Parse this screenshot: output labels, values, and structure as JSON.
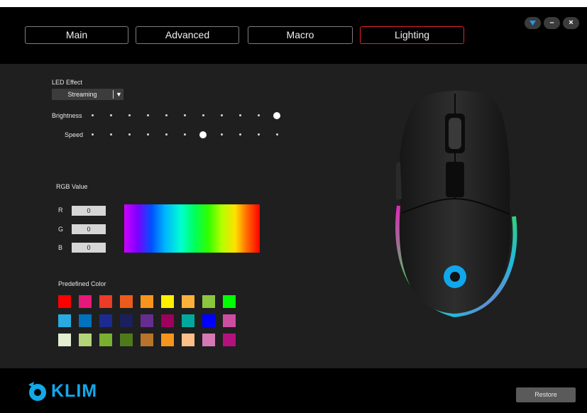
{
  "window": {
    "tabs": [
      {
        "label": "Main"
      },
      {
        "label": "Advanced"
      },
      {
        "label": "Macro"
      },
      {
        "label": "Lighting"
      }
    ],
    "active_tab": "Lighting",
    "controls": {
      "menu_icon": "triangle-down-icon",
      "minimize": "–",
      "close": "×"
    }
  },
  "lighting": {
    "led_effect_label": "LED Effect",
    "led_effect_value": "Streaming",
    "brightness_label": "Brightness",
    "brightness_level": 10,
    "speed_label": "Speed",
    "speed_level": 6,
    "slider_steps": 10,
    "rgb_title": "RGB Value",
    "rgb": [
      {
        "label": "R",
        "value": "0"
      },
      {
        "label": "G",
        "value": "0"
      },
      {
        "label": "B",
        "value": "0"
      }
    ],
    "predefined_title": "Predefined Color",
    "predefined_colors": [
      [
        "#ff0000",
        "#e6197a",
        "#ec3b26",
        "#ec5b1c",
        "#f7941d",
        "#ffef00",
        "#fbb03b",
        "#8cc63f",
        "#00ff00"
      ],
      [
        "#29abe2",
        "#0071bc",
        "#1b2b8f",
        "#1b1f5c",
        "#662d91",
        "#9e005d",
        "#00a99d",
        "#0000ff",
        "#cd4ea1"
      ],
      [
        "#e2edd2",
        "#b4d47a",
        "#7ab030",
        "#4e7a1c",
        "#b8742a",
        "#f7941d",
        "#fbc08a",
        "#d678b4",
        "#b3127e"
      ]
    ]
  },
  "footer": {
    "brand": "KLIM",
    "restore_label": "Restore"
  },
  "colors": {
    "accent_active_tab": "#e2222b",
    "brand_blue": "#12a8ea",
    "panel_bg": "#1f1f1f"
  }
}
